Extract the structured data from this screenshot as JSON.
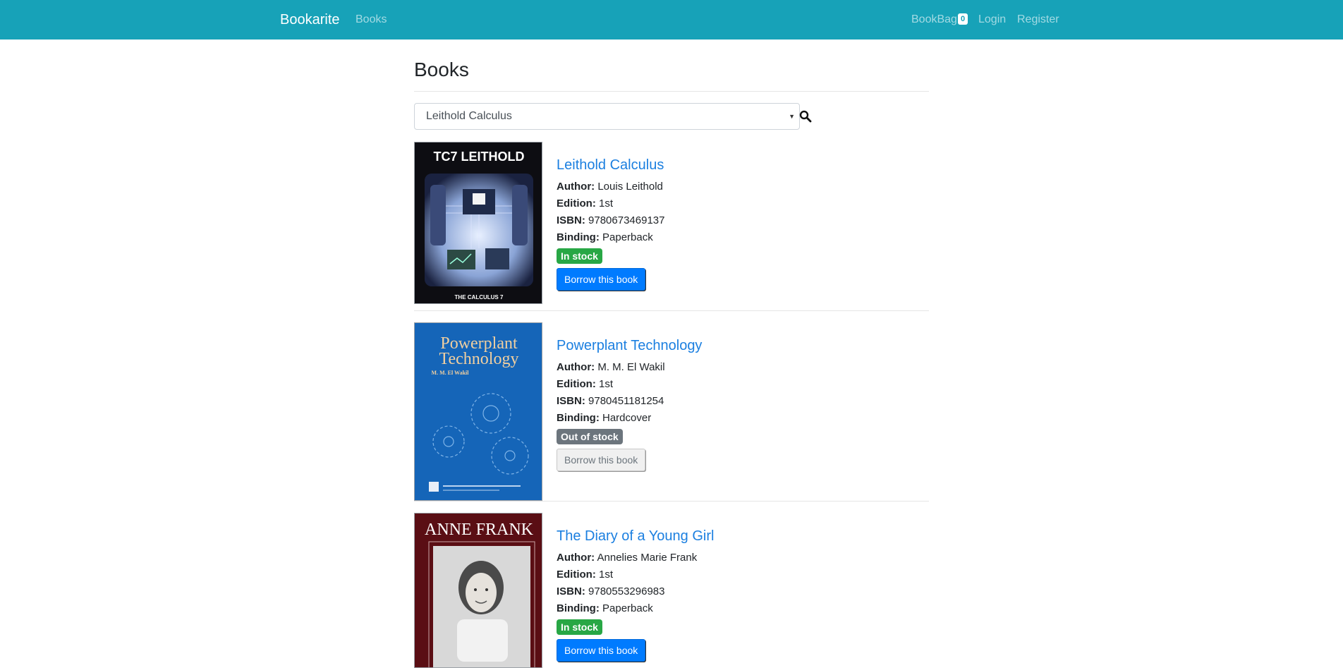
{
  "navbar": {
    "brand": "Bookarite",
    "books_link": "Books",
    "bookbag_label": "BookBag",
    "bookbag_count": "0",
    "login": "Login",
    "register": "Register",
    "background": "#17a2b8"
  },
  "page": {
    "title": "Books"
  },
  "search": {
    "selected": "Leithold Calculus"
  },
  "labels": {
    "author": "Author:",
    "edition": "Edition:",
    "isbn": "ISBN:",
    "binding": "Binding:"
  },
  "books": [
    {
      "title": "Leithold Calculus",
      "author": "Louis Leithold",
      "edition": "1st",
      "isbn": "9780673469137",
      "binding": "Paperback",
      "status": "In stock",
      "button": "Borrow this book",
      "cover_title": "TC7 LEITHOLD",
      "cover_caption": "THE CALCULUS 7"
    },
    {
      "title": "Powerplant Technology",
      "author": "M. M. El Wakil",
      "edition": "1st",
      "isbn": "9780451181254",
      "binding": "Hardcover",
      "status": "Out of stock",
      "button": "Borrow this book",
      "cover_title_line1": "Powerplant",
      "cover_title_line2": "Technology",
      "cover_author": "M. M. El Wakil"
    },
    {
      "title": "The Diary of a Young Girl",
      "author": "Annelies Marie Frank",
      "edition": "1st",
      "isbn": "9780553296983",
      "binding": "Paperback",
      "status": "In stock",
      "button": "Borrow this book",
      "cover_title": "ANNE FRANK"
    }
  ]
}
